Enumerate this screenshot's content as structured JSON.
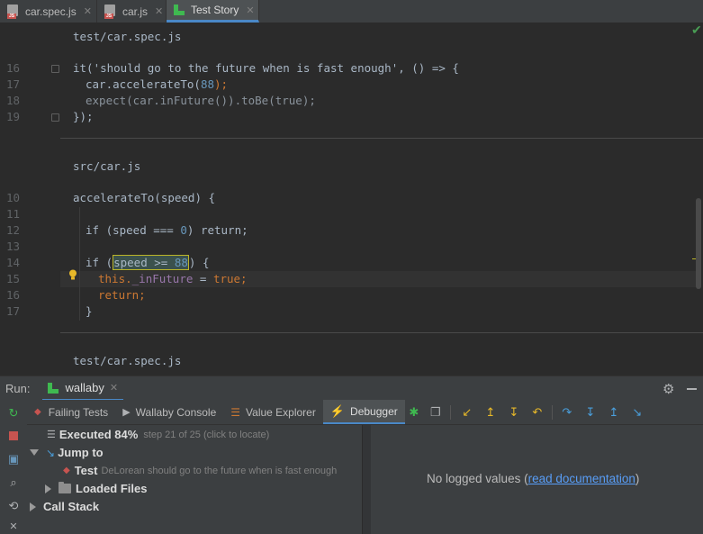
{
  "tabs": [
    {
      "label": "car.spec.js",
      "icon": "js-file-icon"
    },
    {
      "label": "car.js",
      "icon": "js-file-icon"
    },
    {
      "label": "Test Story",
      "icon": "wallaby-icon",
      "active": true
    }
  ],
  "editor": {
    "sections": [
      {
        "label": "test/car.spec.js"
      },
      {
        "label": "src/car.js"
      },
      {
        "label": "test/car.spec.js"
      }
    ],
    "spec_lines": [
      "16",
      "17",
      "18",
      "19"
    ],
    "spec_code": {
      "l16": "it('should go to the future when is fast enough', () => {",
      "l17a": "car.accelerateTo(",
      "l17b": "88",
      "l17c": ");",
      "l18": "expect(car.inFuture()).toBe(true);",
      "l19": "});"
    },
    "src_lines": [
      "10",
      "11",
      "12",
      "13",
      "14",
      "15",
      "16",
      "17"
    ],
    "src_code": {
      "l10": "accelerateTo(speed) {",
      "l12a": "if (speed === ",
      "l12b": "0",
      "l12c": ") return;",
      "l14a": "if (",
      "l14b": "speed >= ",
      "l14c": "88",
      "l14d": ") {",
      "l15a": "this.",
      "l15b": "_inFuture",
      "l15c": " = ",
      "l15d": "true;",
      "l16": "return;",
      "l17": "}"
    }
  },
  "run": {
    "label": "Run:",
    "tab": "wallaby",
    "panel_tabs": [
      "Failing Tests",
      "Wallaby Console",
      "Value Explorer",
      "Debugger"
    ],
    "tree": {
      "executed_title": "Executed 84%",
      "executed_detail": "step 21 of 25 (click to locate)",
      "jump_to": "Jump to",
      "test_label": "Test",
      "test_detail": "DeLorean should go to the future when is fast enough",
      "loaded_files": "Loaded Files",
      "call_stack": "Call Stack"
    },
    "values": {
      "text_before": "No logged values (",
      "link": "read documentation",
      "text_after": ")"
    }
  },
  "colors": {
    "accent": "#4a88c7",
    "green": "#3fb950",
    "keyword": "#cc7832",
    "number": "#6897bb"
  }
}
